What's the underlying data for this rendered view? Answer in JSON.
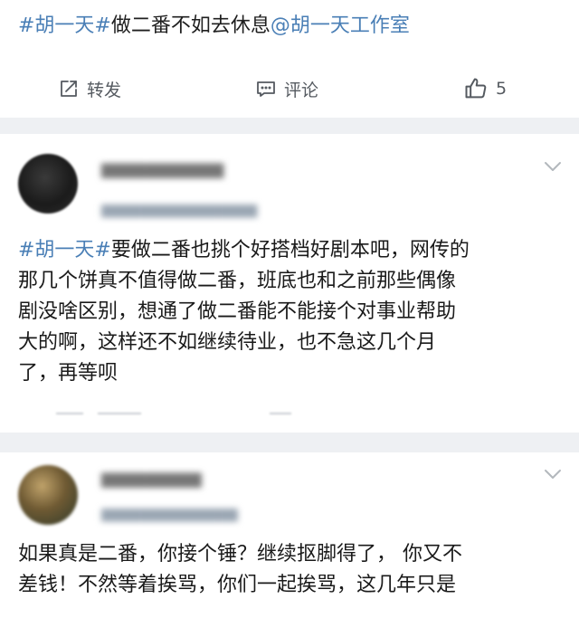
{
  "post": {
    "hashtag": "#胡一天#",
    "text": "做二番不如去休息",
    "mention": "@胡一天工作室",
    "actions": {
      "repost_label": "转发",
      "comment_label": "评论",
      "like_count": "5"
    }
  },
  "comments": [
    {
      "hashtag": "#胡一天#",
      "lines": [
        "要做二番也挑个好搭档好剧本吧，网传的",
        "那几个饼真不值得做二番，班底也和之前那些偶像",
        "剧没啥区别，想通了做二番能不能接个对事业帮助",
        "大的啊，这样还不如继续待业，也不急这几个月",
        "了，再等呗"
      ]
    },
    {
      "lines": [
        "如果真是二番，你接个锤？继续抠脚得了， 你又不",
        "差钱！不然等着挨骂，你们一起挨骂，这几年只是"
      ]
    }
  ],
  "colors": {
    "link": "#4a7fb6",
    "text": "#1f1f1f",
    "muted": "#555a60",
    "divider": "#eef0f3"
  },
  "icons": {
    "repost": "repost-icon",
    "comment": "comment-icon",
    "like": "thumbs-up-icon",
    "menu": "chevron-down-icon"
  }
}
